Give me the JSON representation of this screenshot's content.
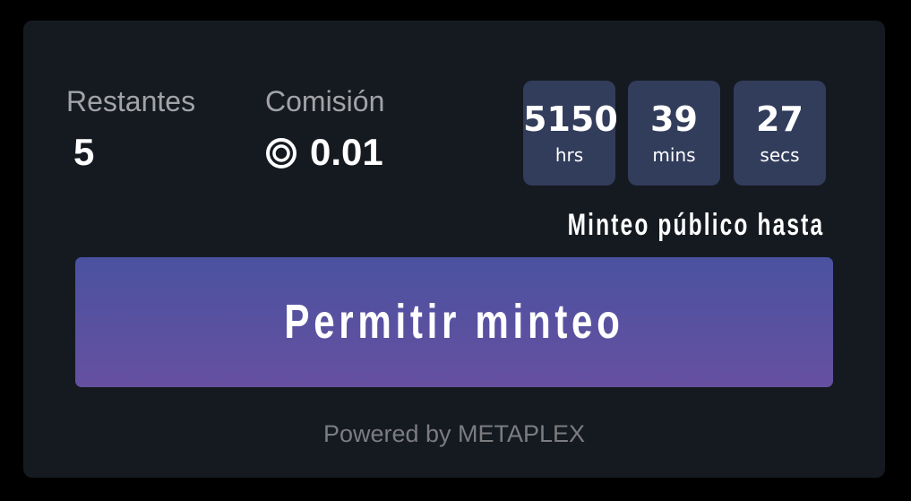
{
  "stats": {
    "remaining_label": "Restantes",
    "remaining_value": "5",
    "fee_label": "Comisión",
    "fee_value": "0.01",
    "fee_icon": "coin-icon"
  },
  "countdown": {
    "hours": {
      "value": "5150",
      "unit": "hrs"
    },
    "minutes": {
      "value": "39",
      "unit": "mins"
    },
    "seconds": {
      "value": "27",
      "unit": "secs"
    },
    "caption": "Minteo público hasta"
  },
  "mint_button": {
    "label": "Permitir minteo"
  },
  "footer": {
    "powered_by": "Powered by METAPLEX"
  },
  "colors": {
    "page_background": "#000000",
    "card_background": "#151a21",
    "timer_box": "#323d5c",
    "button_gradient_top": "#4a52a0",
    "button_gradient_bottom": "#6650a0",
    "muted_text": "#a3a3a6"
  }
}
